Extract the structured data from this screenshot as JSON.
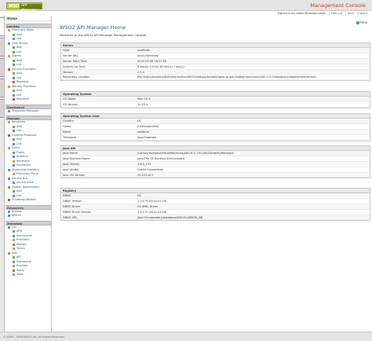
{
  "header": {
    "logo_wso2": "WSO2",
    "logo_product": "API Manager",
    "console_title": "Management Console"
  },
  "subbar": {
    "signed_in": "Signed-in as: admin@carbon.super",
    "sign_out": "Sign-out",
    "docs": "Docs",
    "about": "About"
  },
  "sidebar": {
    "home": "Home",
    "sections": [
      {
        "title": "Identity",
        "items": [
          {
            "label": "Users and Roles",
            "level": 1,
            "icon": "users-icon",
            "color": "#e39a2f"
          },
          {
            "label": "Add",
            "level": 2,
            "icon": "add-icon",
            "color": "#6db33f"
          },
          {
            "label": "List",
            "level": 2,
            "icon": "list-icon",
            "color": "#5b8fc7"
          },
          {
            "label": "User Stores",
            "level": 1,
            "icon": "database-icon",
            "color": "#5b8fc7"
          },
          {
            "label": "Add",
            "level": 2,
            "icon": "add-icon",
            "color": "#6db33f"
          },
          {
            "label": "List",
            "level": 2,
            "icon": "list-icon",
            "color": "#5b8fc7"
          },
          {
            "label": "Claims",
            "level": 1,
            "icon": "claims-icon",
            "color": "#e39a2f"
          },
          {
            "label": "Add",
            "level": 2,
            "icon": "add-icon",
            "color": "#6db33f"
          },
          {
            "label": "List",
            "level": 2,
            "icon": "list-icon",
            "color": "#5b8fc7"
          },
          {
            "label": "Service Providers",
            "level": 1,
            "icon": "service-provider-icon",
            "color": "#d64f3a"
          },
          {
            "label": "Add",
            "level": 2,
            "icon": "add-icon",
            "color": "#6db33f"
          },
          {
            "label": "List",
            "level": 2,
            "icon": "list-icon",
            "color": "#5b8fc7"
          },
          {
            "label": "Resident",
            "level": 2,
            "icon": "resident-icon",
            "color": "#d64f3a"
          },
          {
            "label": "Identity Providers",
            "level": 1,
            "icon": "identity-provider-icon",
            "color": "#e39a2f"
          },
          {
            "label": "Add",
            "level": 2,
            "icon": "add-icon",
            "color": "#6db33f"
          },
          {
            "label": "List",
            "level": 2,
            "icon": "list-icon",
            "color": "#5b8fc7"
          },
          {
            "label": "Resident",
            "level": 2,
            "icon": "resident-icon",
            "color": "#d64f3a"
          }
        ]
      },
      {
        "title": "Dashboard",
        "items": [
          {
            "label": "Templates Manager",
            "level": 1,
            "icon": "template-icon",
            "color": "#5b8fc7"
          }
        ]
      },
      {
        "title": "Manage",
        "items": [
          {
            "label": "Keystores",
            "level": 1,
            "icon": "key-icon",
            "color": "#e39a2f"
          },
          {
            "label": "Add",
            "level": 2,
            "icon": "add-icon",
            "color": "#6db33f"
          },
          {
            "label": "List",
            "level": 2,
            "icon": "list-icon",
            "color": "#5b8fc7"
          },
          {
            "label": "Consent Purposes",
            "level": 1,
            "icon": "consent-icon",
            "color": "#d64f3a"
          },
          {
            "label": "Add",
            "level": 2,
            "icon": "add-icon",
            "color": "#6db33f"
          },
          {
            "label": "List",
            "level": 2,
            "icon": "list-icon",
            "color": "#5b8fc7"
          },
          {
            "label": "Event",
            "level": 1,
            "icon": "event-icon",
            "color": "#e39a2f"
          },
          {
            "label": "Flows",
            "level": 2,
            "icon": "flows-icon",
            "color": "#5b8fc7"
          },
          {
            "label": "Streams",
            "level": 2,
            "icon": "streams-icon",
            "color": "#5b8fc7"
          },
          {
            "label": "Receivers",
            "level": 2,
            "icon": "receivers-icon",
            "color": "#e39a2f"
          },
          {
            "label": "Publishers",
            "level": 2,
            "icon": "publishers-icon",
            "color": "#5b8fc7"
          },
          {
            "label": "Streaming Analytics",
            "level": 1,
            "icon": "analytics-icon",
            "color": "#5b8fc7"
          },
          {
            "label": "Execution Plans",
            "level": 2,
            "icon": "execution-plan-icon",
            "color": "#e39a2f"
          },
          {
            "label": "Service Bus",
            "level": 1,
            "icon": "service-bus-icon",
            "color": "#5b8fc7"
          },
          {
            "label": "Source View",
            "level": 2,
            "icon": "source-view-icon",
            "color": "#5b8fc7"
          },
          {
            "label": "Carbon Applications",
            "level": 1,
            "icon": "carbon-app-icon",
            "color": "#6db33f"
          },
          {
            "label": "Add",
            "level": 2,
            "icon": "add-icon",
            "color": "#6db33f"
          },
          {
            "label": "List",
            "level": 2,
            "icon": "list-icon",
            "color": "#5b8fc7"
          },
          {
            "label": "Shutdown/Restart",
            "level": 1,
            "icon": "power-icon",
            "color": "#d64f3a"
          }
        ]
      },
      {
        "title": "Resources",
        "items": [
          {
            "label": "Browse",
            "level": 1,
            "icon": "browse-icon",
            "color": "#5b8fc7"
          },
          {
            "label": "Search",
            "level": 1,
            "icon": "search-icon",
            "color": "#5b8fc7"
          }
        ]
      },
      {
        "title": "Metadata",
        "items": [
          {
            "label": "List",
            "level": 1,
            "icon": "list-icon",
            "color": "#5b8fc7"
          },
          {
            "label": "APIs",
            "level": 2,
            "icon": "api-icon",
            "color": "#6db33f"
          },
          {
            "label": "Documents",
            "level": 2,
            "icon": "document-icon",
            "color": "#5b8fc7"
          },
          {
            "label": "Providers",
            "level": 2,
            "icon": "provider-icon",
            "color": "#e39a2f"
          },
          {
            "label": "Replies",
            "level": 2,
            "icon": "reply-icon",
            "color": "#5b8fc7"
          },
          {
            "label": "Topics",
            "level": 2,
            "icon": "topic-icon",
            "color": "#e39a2f"
          },
          {
            "label": "Add",
            "level": 1,
            "icon": "add-icon",
            "color": "#6db33f"
          },
          {
            "label": "API",
            "level": 2,
            "icon": "api-icon",
            "color": "#6db33f"
          },
          {
            "label": "Document",
            "level": 2,
            "icon": "document-icon",
            "color": "#5b8fc7"
          },
          {
            "label": "Provider",
            "level": 2,
            "icon": "provider-icon",
            "color": "#e39a2f"
          },
          {
            "label": "Reply",
            "level": 2,
            "icon": "reply-icon",
            "color": "#5b8fc7"
          },
          {
            "label": "Topic",
            "level": 2,
            "icon": "topic-icon",
            "color": "#e39a2f"
          }
        ]
      }
    ]
  },
  "main": {
    "help": "Help",
    "title": "WSO2 API Manager Home",
    "welcome": "Welcome to the WSO2 API Manager Management Console",
    "panels": [
      {
        "title": "Server",
        "rows": [
          {
            "key": "Host",
            "value": "localhost"
          },
          {
            "key": "Server URL",
            "value": "local://services/"
          },
          {
            "key": "Server Start Time",
            "value": "2020-05-08 16:27:50"
          },
          {
            "key": "System Up Time",
            "value": "0 day(s) 0 hr(s) 48 min(s) 7 sec(s)"
          },
          {
            "key": "Version",
            "value": "2.5.0"
          },
          {
            "key": "Repository Location",
            "value": "file:/Users/sandima/Documents/Dev/WSO2/setups/Ansible/apim-single-node/product/wso2am-2.5.0/repository/deployment/server/"
          }
        ]
      },
      {
        "title": "Operating System",
        "rows": [
          {
            "key": "OS Name",
            "value": "Mac OS X"
          },
          {
            "key": "OS Version",
            "value": "10.15.4"
          }
        ]
      },
      {
        "title": "Operating System User",
        "rows": [
          {
            "key": "Country",
            "value": "LK"
          },
          {
            "key": "Home",
            "value": "/Users/sandima"
          },
          {
            "key": "Name",
            "value": "sandima"
          },
          {
            "key": "Timezone",
            "value": "Asia/Colombo"
          }
        ]
      },
      {
        "title": "Java VM",
        "rows": [
          {
            "key": "Java Home",
            "value": "/Library/Java/JavaVirtualMachines/jdk1.8.0_231.jdk/Contents/Home/jre"
          },
          {
            "key": "Java Runtime Name",
            "value": "Java(TM) SE Runtime Environment"
          },
          {
            "key": "Java Version",
            "value": "1.8.0_231"
          },
          {
            "key": "Java Vendor",
            "value": "Oracle Corporation"
          },
          {
            "key": "Java VM Version",
            "value": "25.231-b11"
          }
        ]
      },
      {
        "title": "Registry",
        "rows": [
          {
            "key": "DBMS",
            "value": "H2"
          },
          {
            "key": "DBMS Version",
            "value": "1.3.175 (2014-01-18)"
          },
          {
            "key": "DBMS Driver",
            "value": "H2 JDBC Driver"
          },
          {
            "key": "DBMS Driver Version",
            "value": "1.3.175 (2014-01-18)"
          },
          {
            "key": "DBMS URL",
            "value": "jdbc:h2:repository/database/WSO2CARBON_DB"
          }
        ]
      }
    ]
  },
  "footer": {
    "copyright": "© 2005 - 2018 WSO2 Inc. All Rights Reserved."
  }
}
